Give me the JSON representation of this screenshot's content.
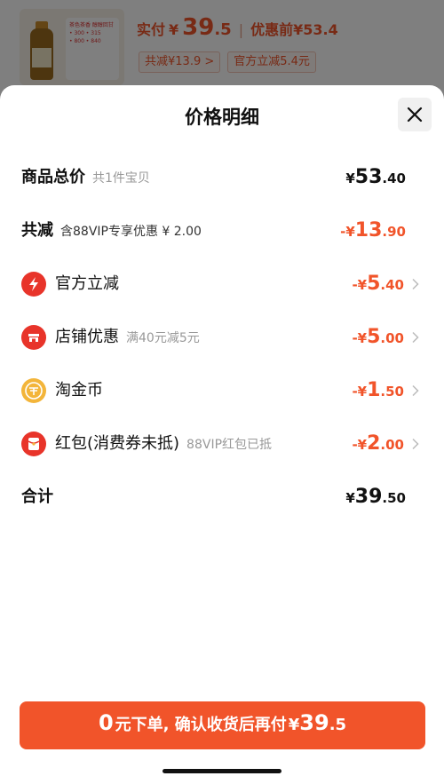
{
  "background": {
    "price_label": "实付",
    "currency": "¥",
    "price_int": "39",
    "price_dec": ".5",
    "separator": "|",
    "before_label": "优惠前¥53.4",
    "tag_discount": "共减¥13.9 >",
    "tag_official": "官方立减5.4元",
    "thumb_promo_title": "茶色茶香 醇醇回甘",
    "thumb_promo_lines": [
      "• 300 • 315",
      "• 800 • 840"
    ]
  },
  "sheet": {
    "title": "价格明细"
  },
  "rows": {
    "total": {
      "label": "商品总价",
      "sub": "共1件宝贝",
      "cur": "¥",
      "int": "53",
      "dec": ".40"
    },
    "reduced": {
      "label": "共减",
      "sub": "含88VIP专享优惠 ¥ 2.00",
      "cur": "-¥",
      "int": "13",
      "dec": ".90"
    },
    "official": {
      "label": "官方立减",
      "cur": "-¥",
      "int": "5",
      "dec": ".40"
    },
    "store": {
      "label": "店铺优惠",
      "sub": "满40元减5元",
      "cur": "-¥",
      "int": "5",
      "dec": ".00"
    },
    "coin": {
      "label": "淘金币",
      "cur": "-¥",
      "int": "1",
      "dec": ".50"
    },
    "redpacket": {
      "label": "红包(消费券未抵)",
      "sub": "88VIP红包已抵",
      "cur": "-¥",
      "int": "2",
      "dec": ".00"
    },
    "sum": {
      "label": "合计",
      "cur": "¥",
      "int": "39",
      "dec": ".50"
    }
  },
  "cta": {
    "zero": "0",
    "text": "元下单, 确认收货后再付",
    "cur": "¥",
    "int": "39",
    "dec": ".5"
  },
  "colors": {
    "accent": "#f1542a",
    "icon_red": "#e8342a",
    "icon_coin": "#f3b53a"
  },
  "icons": {
    "official": "lightning-icon",
    "store": "store-icon",
    "coin": "coin-icon",
    "redpacket": "red-packet-icon",
    "close": "close-icon",
    "chevron": "chevron-right-icon"
  }
}
